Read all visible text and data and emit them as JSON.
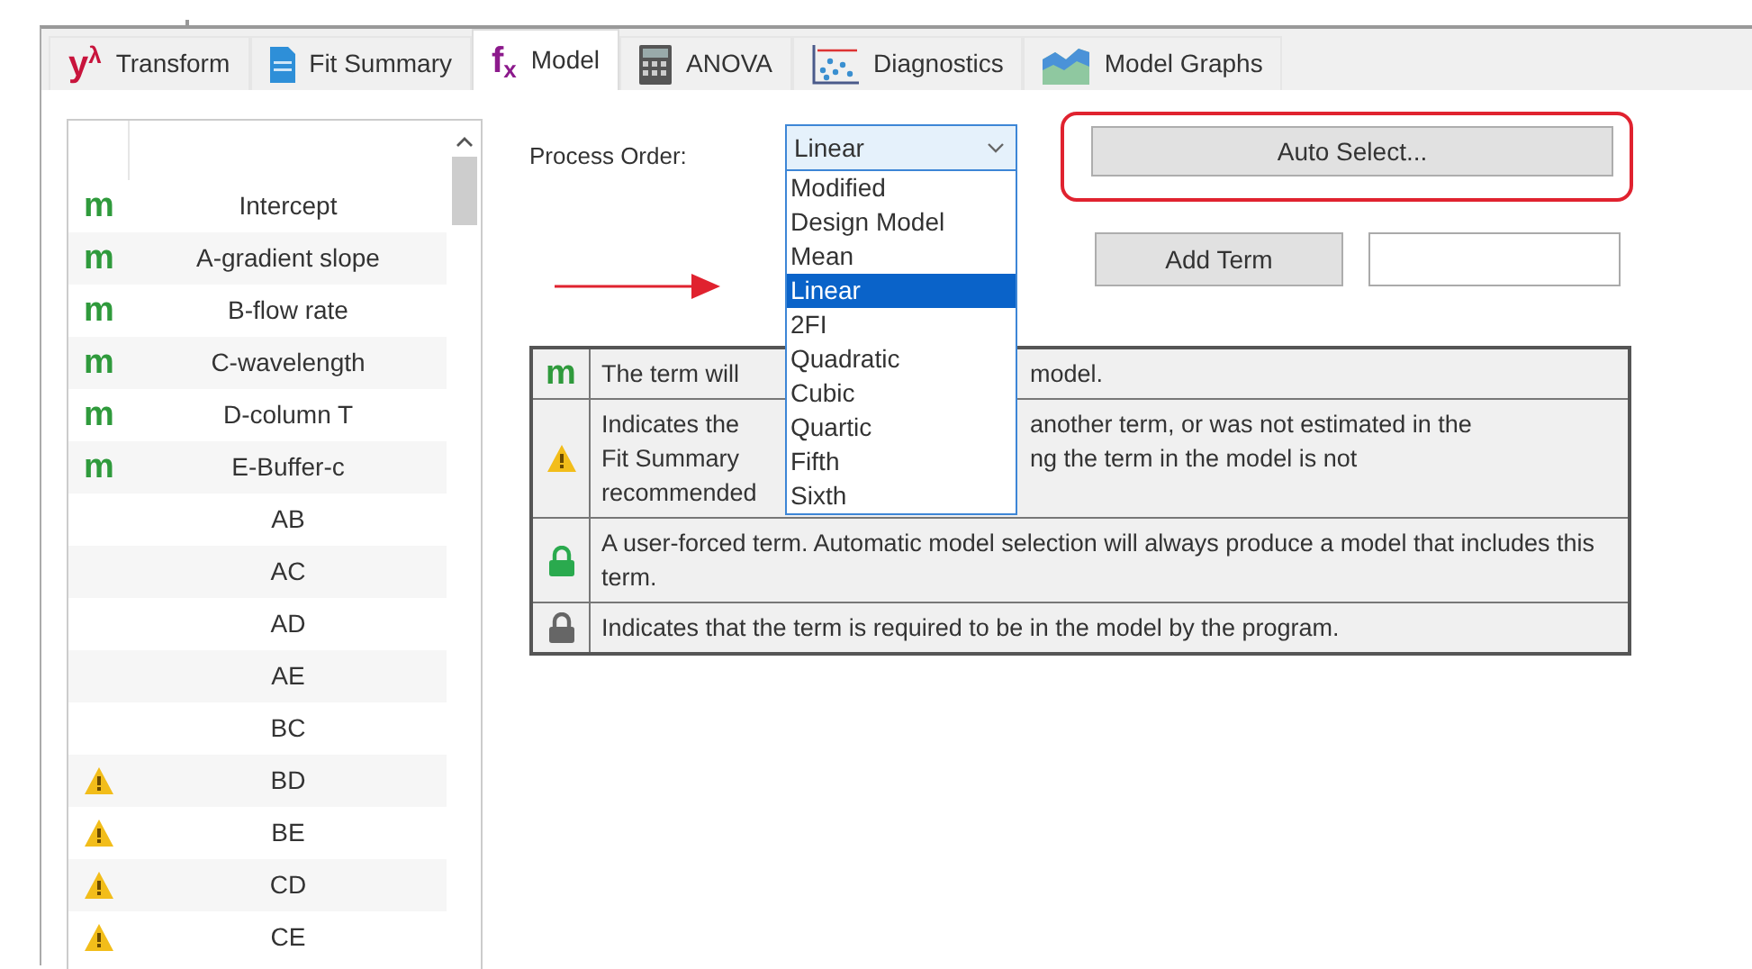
{
  "tabs": [
    {
      "kind": "transform",
      "icon_text": "y$^{λ}$",
      "label": "Transform",
      "selected": false
    },
    {
      "kind": "document",
      "label": "Fit Summary",
      "selected": false
    },
    {
      "kind": "model",
      "icon_text": "f$_{x}$",
      "label": "Model",
      "selected": true
    },
    {
      "kind": "calculator",
      "label": "ANOVA",
      "selected": false
    },
    {
      "kind": "scatter",
      "label": "Diagnostics",
      "selected": false
    },
    {
      "kind": "area",
      "label": "Model Graphs",
      "selected": false
    }
  ],
  "terms": [
    {
      "kind": "text",
      "marker_text": "m",
      "label": "Intercept"
    },
    {
      "kind": "text",
      "marker_text": "m",
      "label": "A-gradient slope"
    },
    {
      "kind": "text",
      "marker_text": "m",
      "label": "B-flow rate"
    },
    {
      "kind": "text",
      "marker_text": "m",
      "label": "C-wavelength"
    },
    {
      "kind": "text",
      "marker_text": "m",
      "label": "D-column T"
    },
    {
      "kind": "text",
      "marker_text": "m",
      "label": "E-Buffer-c"
    },
    {
      "kind": "none",
      "label": "AB"
    },
    {
      "kind": "none",
      "label": "AC"
    },
    {
      "kind": "none",
      "label": "AD"
    },
    {
      "kind": "none",
      "label": "AE"
    },
    {
      "kind": "none",
      "label": "BC"
    },
    {
      "kind": "warning",
      "label": "BD"
    },
    {
      "kind": "warning",
      "label": "BE"
    },
    {
      "kind": "warning",
      "label": "CD"
    },
    {
      "kind": "warning",
      "label": "CE"
    }
  ],
  "process_order": {
    "label": "Process Order:",
    "value": "Linear",
    "expanded": true,
    "options": [
      {
        "label": "Modified",
        "selected": false
      },
      {
        "label": "Design Model",
        "selected": false
      },
      {
        "label": "Mean",
        "selected": false
      },
      {
        "label": "Linear",
        "selected": true
      },
      {
        "label": "2FI",
        "selected": false
      },
      {
        "label": "Quadratic",
        "selected": false
      },
      {
        "label": "Cubic",
        "selected": false
      },
      {
        "label": "Quartic",
        "selected": false
      },
      {
        "label": "Fifth",
        "selected": false
      },
      {
        "label": "Sixth",
        "selected": false
      }
    ]
  },
  "auto_select_button": "Auto Select...",
  "add_term_button": "Add Term",
  "legend": [
    {
      "kind": "text",
      "symbol_text": "m",
      "lines": [
        {
          "left": "The term will",
          "right": "model."
        }
      ]
    },
    {
      "kind": "warning",
      "lines": [
        {
          "left": "Indicates the",
          "right": "another term, or was not estimated in the"
        },
        {
          "left": "Fit Summary",
          "right": "ng the term in the model is not"
        },
        {
          "left": "recommended"
        }
      ]
    },
    {
      "kind": "user-lock",
      "text": "A user-forced term. Automatic model selection will always produce a model that includes this term."
    },
    {
      "kind": "lock",
      "text": "Indicates that the term is required to be in the model by the program."
    }
  ]
}
